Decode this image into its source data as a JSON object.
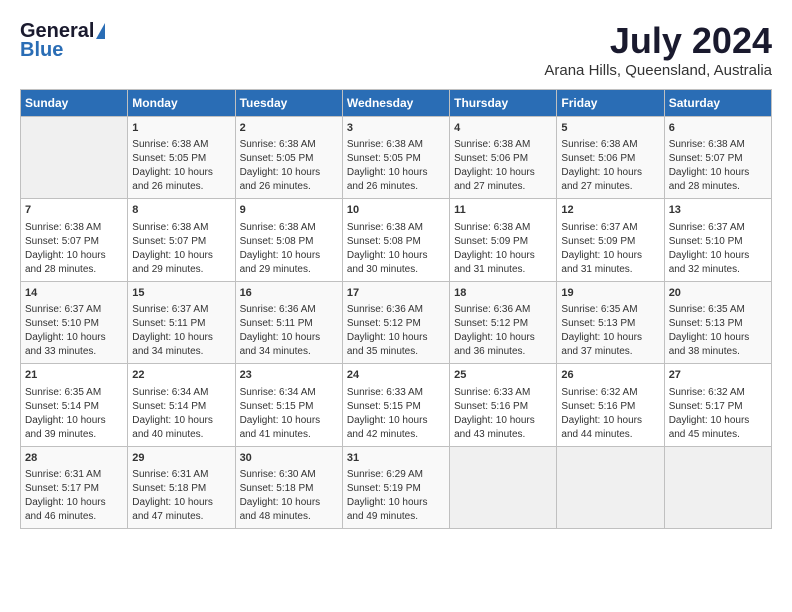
{
  "header": {
    "logo_general": "General",
    "logo_blue": "Blue",
    "month_year": "July 2024",
    "location": "Arana Hills, Queensland, Australia"
  },
  "days_of_week": [
    "Sunday",
    "Monday",
    "Tuesday",
    "Wednesday",
    "Thursday",
    "Friday",
    "Saturday"
  ],
  "weeks": [
    [
      {
        "day": "",
        "info": ""
      },
      {
        "day": "1",
        "info": "Sunrise: 6:38 AM\nSunset: 5:05 PM\nDaylight: 10 hours\nand 26 minutes."
      },
      {
        "day": "2",
        "info": "Sunrise: 6:38 AM\nSunset: 5:05 PM\nDaylight: 10 hours\nand 26 minutes."
      },
      {
        "day": "3",
        "info": "Sunrise: 6:38 AM\nSunset: 5:05 PM\nDaylight: 10 hours\nand 26 minutes."
      },
      {
        "day": "4",
        "info": "Sunrise: 6:38 AM\nSunset: 5:06 PM\nDaylight: 10 hours\nand 27 minutes."
      },
      {
        "day": "5",
        "info": "Sunrise: 6:38 AM\nSunset: 5:06 PM\nDaylight: 10 hours\nand 27 minutes."
      },
      {
        "day": "6",
        "info": "Sunrise: 6:38 AM\nSunset: 5:07 PM\nDaylight: 10 hours\nand 28 minutes."
      }
    ],
    [
      {
        "day": "7",
        "info": "Sunrise: 6:38 AM\nSunset: 5:07 PM\nDaylight: 10 hours\nand 28 minutes."
      },
      {
        "day": "8",
        "info": "Sunrise: 6:38 AM\nSunset: 5:07 PM\nDaylight: 10 hours\nand 29 minutes."
      },
      {
        "day": "9",
        "info": "Sunrise: 6:38 AM\nSunset: 5:08 PM\nDaylight: 10 hours\nand 29 minutes."
      },
      {
        "day": "10",
        "info": "Sunrise: 6:38 AM\nSunset: 5:08 PM\nDaylight: 10 hours\nand 30 minutes."
      },
      {
        "day": "11",
        "info": "Sunrise: 6:38 AM\nSunset: 5:09 PM\nDaylight: 10 hours\nand 31 minutes."
      },
      {
        "day": "12",
        "info": "Sunrise: 6:37 AM\nSunset: 5:09 PM\nDaylight: 10 hours\nand 31 minutes."
      },
      {
        "day": "13",
        "info": "Sunrise: 6:37 AM\nSunset: 5:10 PM\nDaylight: 10 hours\nand 32 minutes."
      }
    ],
    [
      {
        "day": "14",
        "info": "Sunrise: 6:37 AM\nSunset: 5:10 PM\nDaylight: 10 hours\nand 33 minutes."
      },
      {
        "day": "15",
        "info": "Sunrise: 6:37 AM\nSunset: 5:11 PM\nDaylight: 10 hours\nand 34 minutes."
      },
      {
        "day": "16",
        "info": "Sunrise: 6:36 AM\nSunset: 5:11 PM\nDaylight: 10 hours\nand 34 minutes."
      },
      {
        "day": "17",
        "info": "Sunrise: 6:36 AM\nSunset: 5:12 PM\nDaylight: 10 hours\nand 35 minutes."
      },
      {
        "day": "18",
        "info": "Sunrise: 6:36 AM\nSunset: 5:12 PM\nDaylight: 10 hours\nand 36 minutes."
      },
      {
        "day": "19",
        "info": "Sunrise: 6:35 AM\nSunset: 5:13 PM\nDaylight: 10 hours\nand 37 minutes."
      },
      {
        "day": "20",
        "info": "Sunrise: 6:35 AM\nSunset: 5:13 PM\nDaylight: 10 hours\nand 38 minutes."
      }
    ],
    [
      {
        "day": "21",
        "info": "Sunrise: 6:35 AM\nSunset: 5:14 PM\nDaylight: 10 hours\nand 39 minutes."
      },
      {
        "day": "22",
        "info": "Sunrise: 6:34 AM\nSunset: 5:14 PM\nDaylight: 10 hours\nand 40 minutes."
      },
      {
        "day": "23",
        "info": "Sunrise: 6:34 AM\nSunset: 5:15 PM\nDaylight: 10 hours\nand 41 minutes."
      },
      {
        "day": "24",
        "info": "Sunrise: 6:33 AM\nSunset: 5:15 PM\nDaylight: 10 hours\nand 42 minutes."
      },
      {
        "day": "25",
        "info": "Sunrise: 6:33 AM\nSunset: 5:16 PM\nDaylight: 10 hours\nand 43 minutes."
      },
      {
        "day": "26",
        "info": "Sunrise: 6:32 AM\nSunset: 5:16 PM\nDaylight: 10 hours\nand 44 minutes."
      },
      {
        "day": "27",
        "info": "Sunrise: 6:32 AM\nSunset: 5:17 PM\nDaylight: 10 hours\nand 45 minutes."
      }
    ],
    [
      {
        "day": "28",
        "info": "Sunrise: 6:31 AM\nSunset: 5:17 PM\nDaylight: 10 hours\nand 46 minutes."
      },
      {
        "day": "29",
        "info": "Sunrise: 6:31 AM\nSunset: 5:18 PM\nDaylight: 10 hours\nand 47 minutes."
      },
      {
        "day": "30",
        "info": "Sunrise: 6:30 AM\nSunset: 5:18 PM\nDaylight: 10 hours\nand 48 minutes."
      },
      {
        "day": "31",
        "info": "Sunrise: 6:29 AM\nSunset: 5:19 PM\nDaylight: 10 hours\nand 49 minutes."
      },
      {
        "day": "",
        "info": ""
      },
      {
        "day": "",
        "info": ""
      },
      {
        "day": "",
        "info": ""
      }
    ]
  ]
}
